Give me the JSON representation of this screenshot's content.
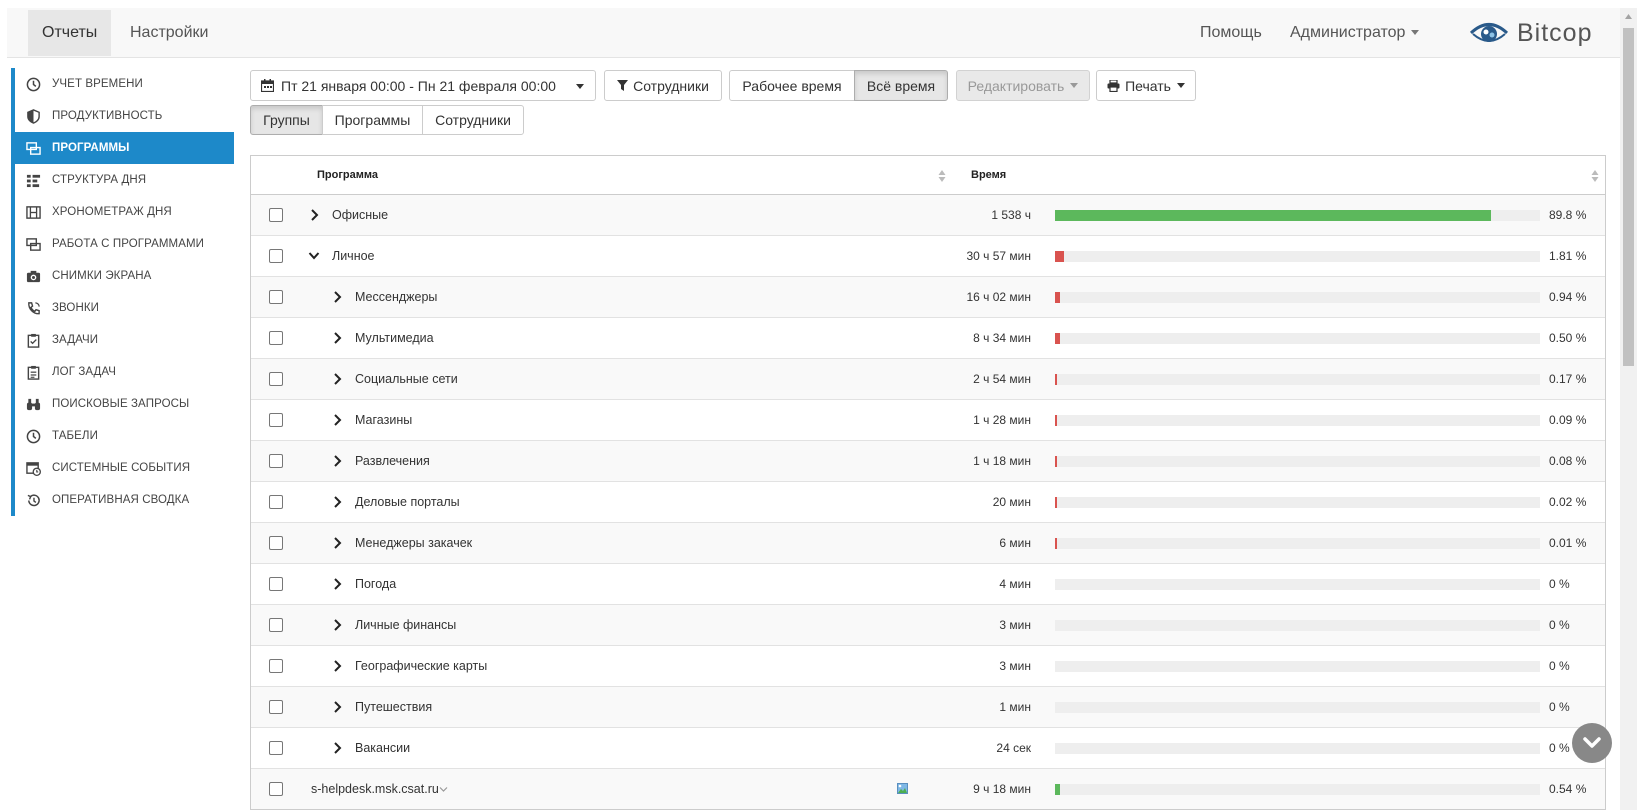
{
  "nav": {
    "tabs": [
      {
        "label": "Отчеты",
        "active": true
      },
      {
        "label": "Настройки",
        "active": false
      }
    ],
    "help": "Помощь",
    "user": "Администратор",
    "logo_text": "Bitcop"
  },
  "sidebar": {
    "accent_color": "#1d89c9",
    "items": [
      {
        "label": "Учет времени",
        "icon": "clock-icon",
        "active": false
      },
      {
        "label": "Продуктивность",
        "icon": "shield-icon",
        "active": false
      },
      {
        "label": "Программы",
        "icon": "windows-icon",
        "active": true
      },
      {
        "label": "Структура дня",
        "icon": "grid-list-icon",
        "active": false
      },
      {
        "label": "Хронометраж дня",
        "icon": "film-icon",
        "active": false
      },
      {
        "label": "Работа с программами",
        "icon": "windows-icon",
        "active": false
      },
      {
        "label": "Снимки экрана",
        "icon": "camera-icon",
        "active": false
      },
      {
        "label": "Звонки",
        "icon": "phone-icon",
        "active": false
      },
      {
        "label": "Задачи",
        "icon": "clipboard-icon",
        "active": false
      },
      {
        "label": "Лог задач",
        "icon": "clipboard-list-icon",
        "active": false
      },
      {
        "label": "Поисковые запросы",
        "icon": "binoculars-icon",
        "active": false
      },
      {
        "label": "Табели",
        "icon": "clock-icon",
        "active": false
      },
      {
        "label": "Системные события",
        "icon": "calendar-clock-icon",
        "active": false
      },
      {
        "label": "Оперативная сводка",
        "icon": "history-icon",
        "active": false
      }
    ]
  },
  "toolbar": {
    "date_range": "Пт 21 января 00:00 - Пн 21 февраля 00:00",
    "employees_filter": "Сотрудники",
    "work_time": "Рабочее время",
    "all_time": "Всё время",
    "edit": "Редактировать",
    "print": "Печать"
  },
  "view_tabs": [
    {
      "label": "Группы",
      "active": true
    },
    {
      "label": "Программы",
      "active": false
    },
    {
      "label": "Сотрудники",
      "active": false
    }
  ],
  "table": {
    "columns": [
      "Программа",
      "Время"
    ],
    "rows": [
      {
        "name": "Офисные",
        "level": 0,
        "expanded": false,
        "time": "1 538 ч",
        "percent": 89.8,
        "percent_label": "89.8 %",
        "color": "#5cb85c"
      },
      {
        "name": "Личное",
        "level": 0,
        "expanded": true,
        "time": "30 ч 57 мин",
        "percent": 1.81,
        "percent_label": "1.81 %",
        "color": "#d9534f"
      },
      {
        "name": "Мессенджеры",
        "level": 1,
        "expanded": false,
        "time": "16 ч 02 мин",
        "percent": 0.94,
        "percent_label": "0.94 %",
        "color": "#d9534f"
      },
      {
        "name": "Мультимедиа",
        "level": 1,
        "expanded": false,
        "time": "8 ч 34 мин",
        "percent": 0.5,
        "percent_label": "0.50 %",
        "color": "#d9534f"
      },
      {
        "name": "Социальные сети",
        "level": 1,
        "expanded": false,
        "time": "2 ч 54 мин",
        "percent": 0.17,
        "percent_label": "0.17 %",
        "color": "#d9534f"
      },
      {
        "name": "Магазины",
        "level": 1,
        "expanded": false,
        "time": "1 ч 28 мин",
        "percent": 0.09,
        "percent_label": "0.09 %",
        "color": "#d9534f"
      },
      {
        "name": "Развлечения",
        "level": 1,
        "expanded": false,
        "time": "1 ч 18 мин",
        "percent": 0.08,
        "percent_label": "0.08 %",
        "color": "#d9534f"
      },
      {
        "name": "Деловые порталы",
        "level": 1,
        "expanded": false,
        "time": "20 мин",
        "percent": 0.02,
        "percent_label": "0.02 %",
        "color": "#d9534f"
      },
      {
        "name": "Менеджеры закачек",
        "level": 1,
        "expanded": false,
        "time": "6 мин",
        "percent": 0.01,
        "percent_label": "0.01 %",
        "color": "#d9534f"
      },
      {
        "name": "Погода",
        "level": 1,
        "expanded": false,
        "time": "4 мин",
        "percent": 0,
        "percent_label": "0 %",
        "color": "#d9534f"
      },
      {
        "name": "Личные финансы",
        "level": 1,
        "expanded": false,
        "time": "3 мин",
        "percent": 0,
        "percent_label": "0 %",
        "color": "#d9534f"
      },
      {
        "name": "Географические карты",
        "level": 1,
        "expanded": false,
        "time": "3 мин",
        "percent": 0,
        "percent_label": "0 %",
        "color": "#d9534f"
      },
      {
        "name": "Путешествия",
        "level": 1,
        "expanded": false,
        "time": "1 мин",
        "percent": 0,
        "percent_label": "0 %",
        "color": "#d9534f"
      },
      {
        "name": "Вакансии",
        "level": 1,
        "expanded": false,
        "time": "24 сек",
        "percent": 0,
        "percent_label": "0 %",
        "color": "#d9534f"
      },
      {
        "name": "s-helpdesk.msk.csat.ru",
        "level": 0,
        "expanded": false,
        "is_host": true,
        "time": "9 ч 18 мин",
        "percent": 0.54,
        "percent_label": "0.54 %",
        "color": "#5cb85c"
      }
    ]
  }
}
